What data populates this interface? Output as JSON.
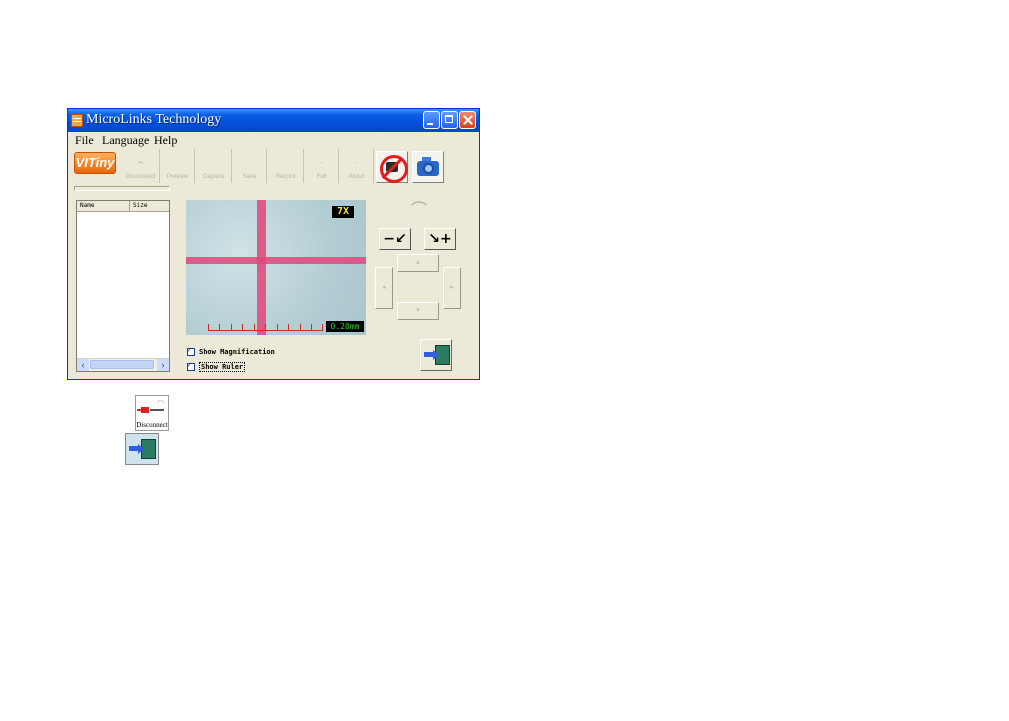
{
  "window": {
    "title": "MicroLinks Technology"
  },
  "menu": [
    "File",
    "Language",
    "Help"
  ],
  "toolbar": {
    "logo": "VITiny",
    "disabled_buttons": [
      "Disconnect",
      "Preview",
      "Capture",
      "Save",
      "Record",
      "Full",
      "About"
    ]
  },
  "file_list": {
    "columns": [
      "Name",
      "Size"
    ]
  },
  "preview": {
    "magnification": "7X",
    "scale_label": "0.20mm"
  },
  "options": {
    "show_magnification": "Show Magnification",
    "show_ruler": "Show Ruler"
  },
  "zoom": {
    "out": "−↙",
    "in": "↘+"
  },
  "icons_below": {
    "disconnect_label": "Disconnect"
  }
}
